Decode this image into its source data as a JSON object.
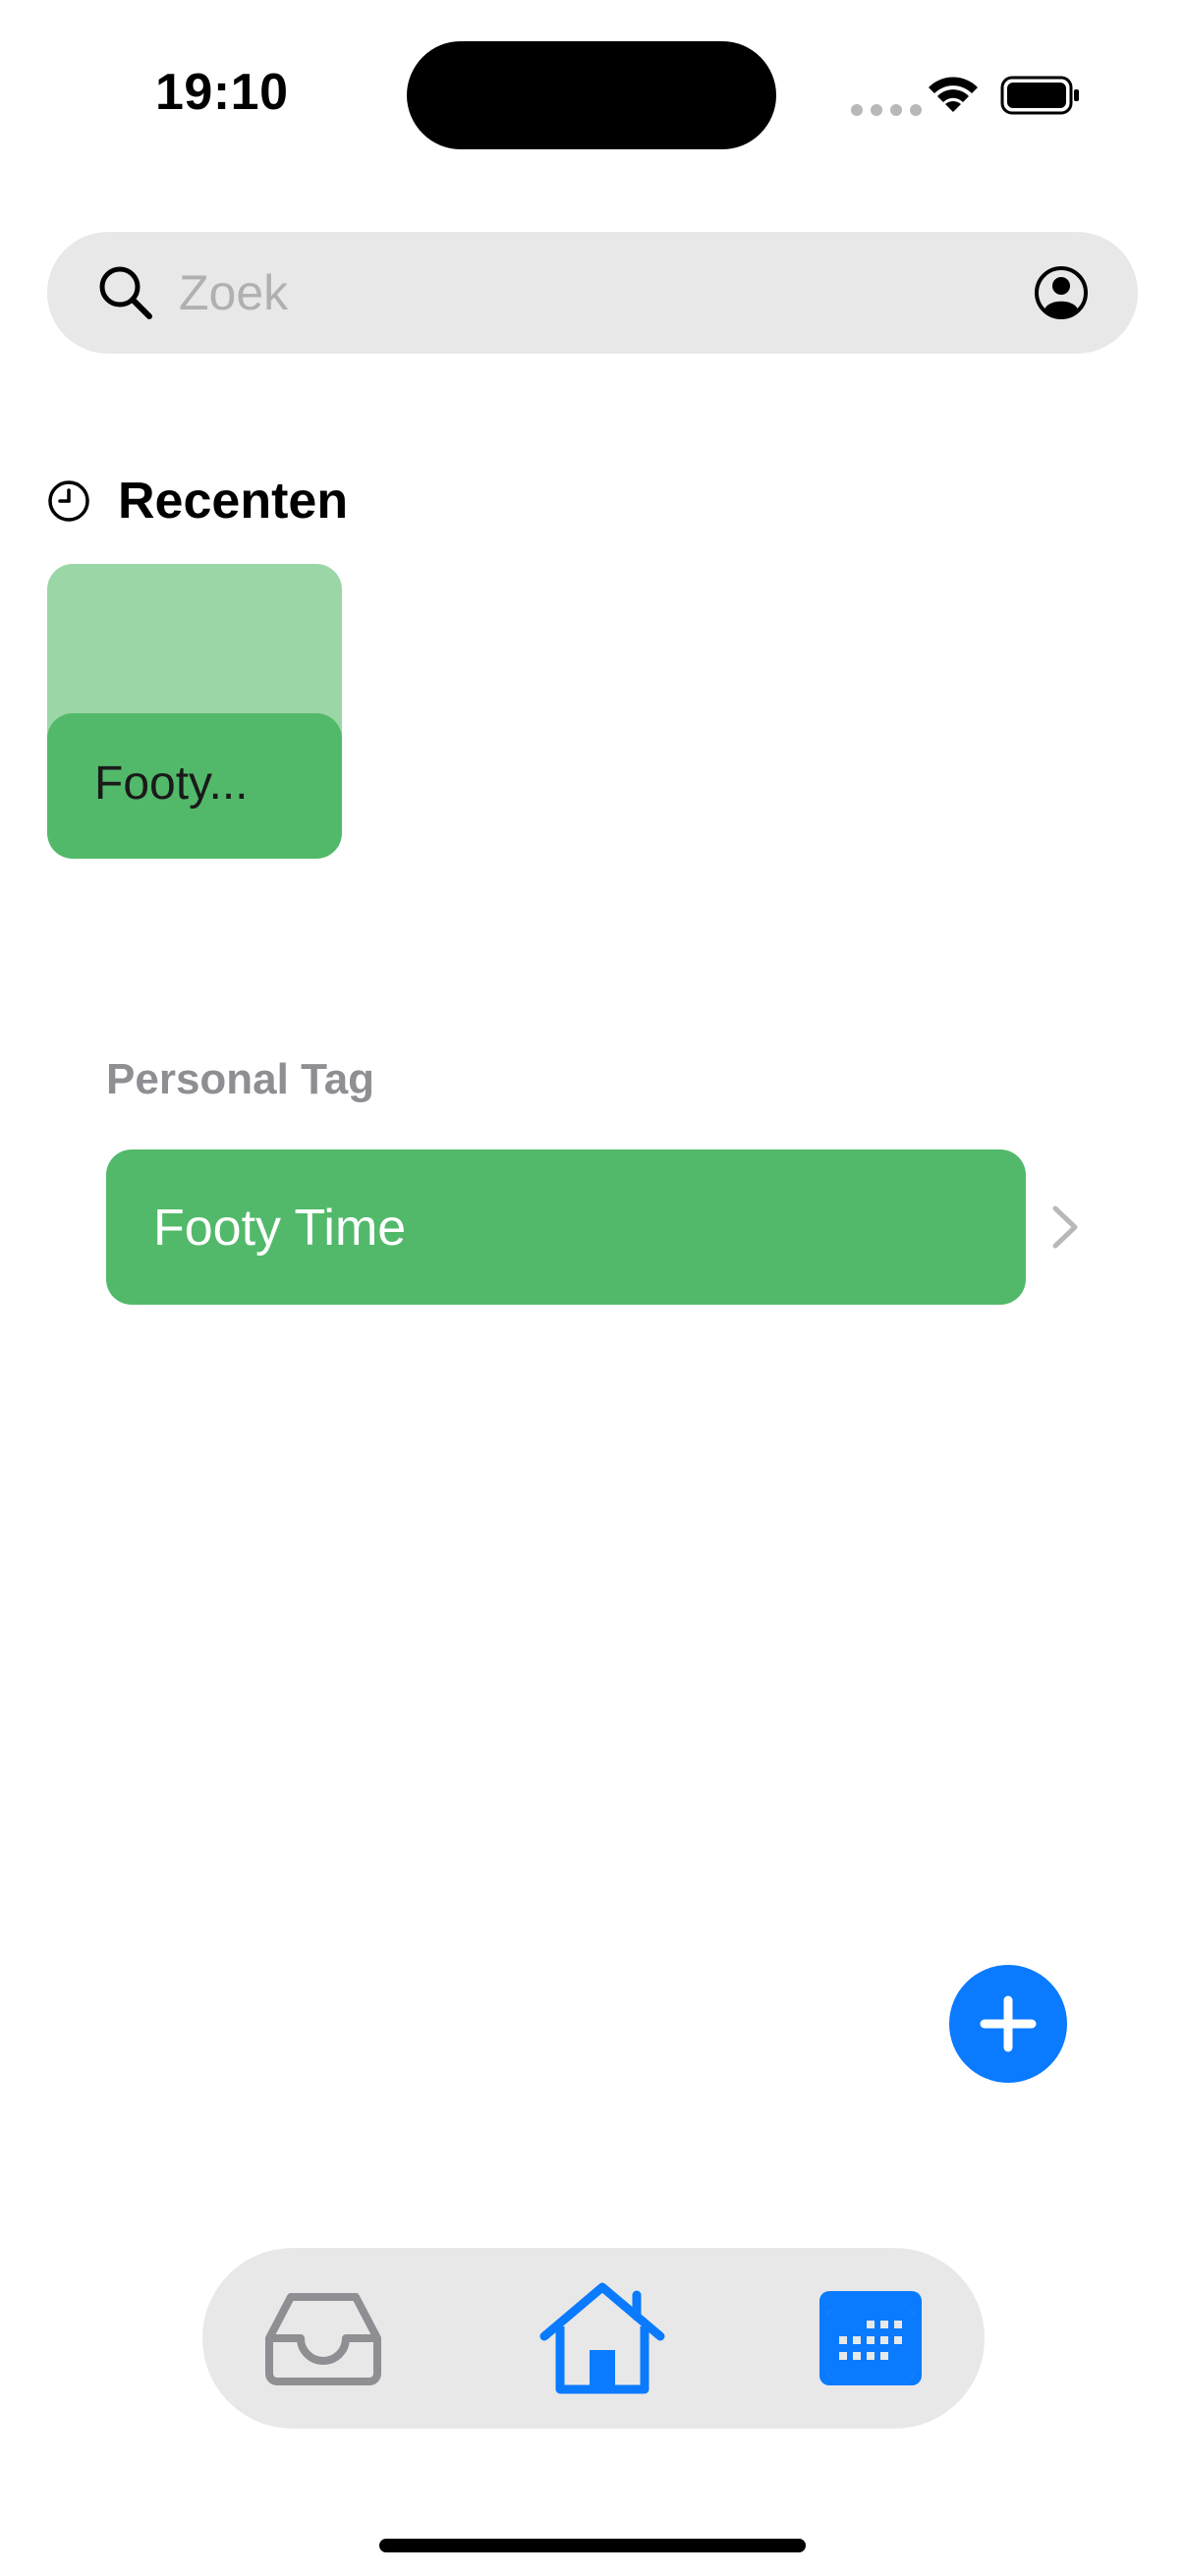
{
  "status_bar": {
    "time": "19:10"
  },
  "search": {
    "placeholder": "Zoek"
  },
  "recents": {
    "title": "Recenten",
    "items": [
      {
        "label": "Footy..."
      }
    ]
  },
  "personal_tag": {
    "section_label": "Personal Tag",
    "items": [
      {
        "label": "Footy Time"
      }
    ]
  },
  "colors": {
    "accent": "#0a7aff",
    "tag_green": "#52b96a",
    "tag_green_light": "#9bd6a7",
    "surface": "#e8e8e8",
    "secondary_text": "#8e8e93"
  },
  "icons": {
    "search": "search-icon",
    "account": "person-circle-icon",
    "recents": "clock-icon",
    "chevron": "chevron-right-icon",
    "add": "plus-icon",
    "tabs": [
      "inbox-tray-icon",
      "house-icon",
      "calendar-icon"
    ]
  }
}
